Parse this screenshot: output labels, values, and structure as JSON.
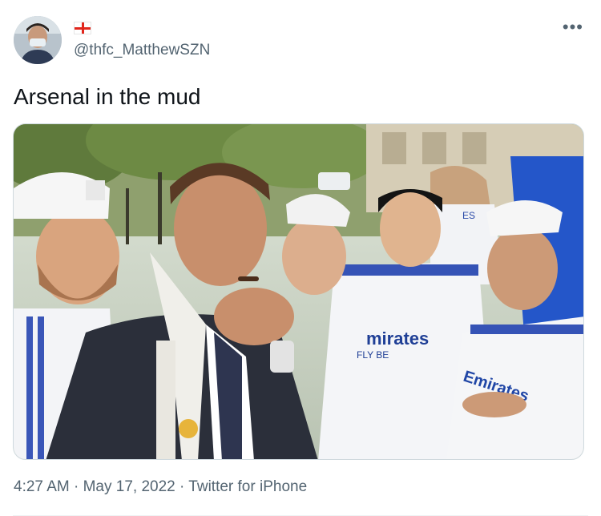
{
  "author": {
    "handle": "@thfc_MatthewSZN",
    "flag_icon": "england-flag-icon"
  },
  "tweet": {
    "text": "Arsenal in the mud"
  },
  "media": {
    "shirt_text_1": "mirates",
    "shirt_text_2": "FLY BE",
    "shirt_text_3": "Emirates",
    "cap_text": "ES"
  },
  "meta": {
    "time": "4:27 AM",
    "separator": " · ",
    "date": "May 17, 2022",
    "source": "Twitter for iPhone"
  },
  "colors": {
    "text_primary": "#0f1419",
    "text_secondary": "#536471"
  }
}
